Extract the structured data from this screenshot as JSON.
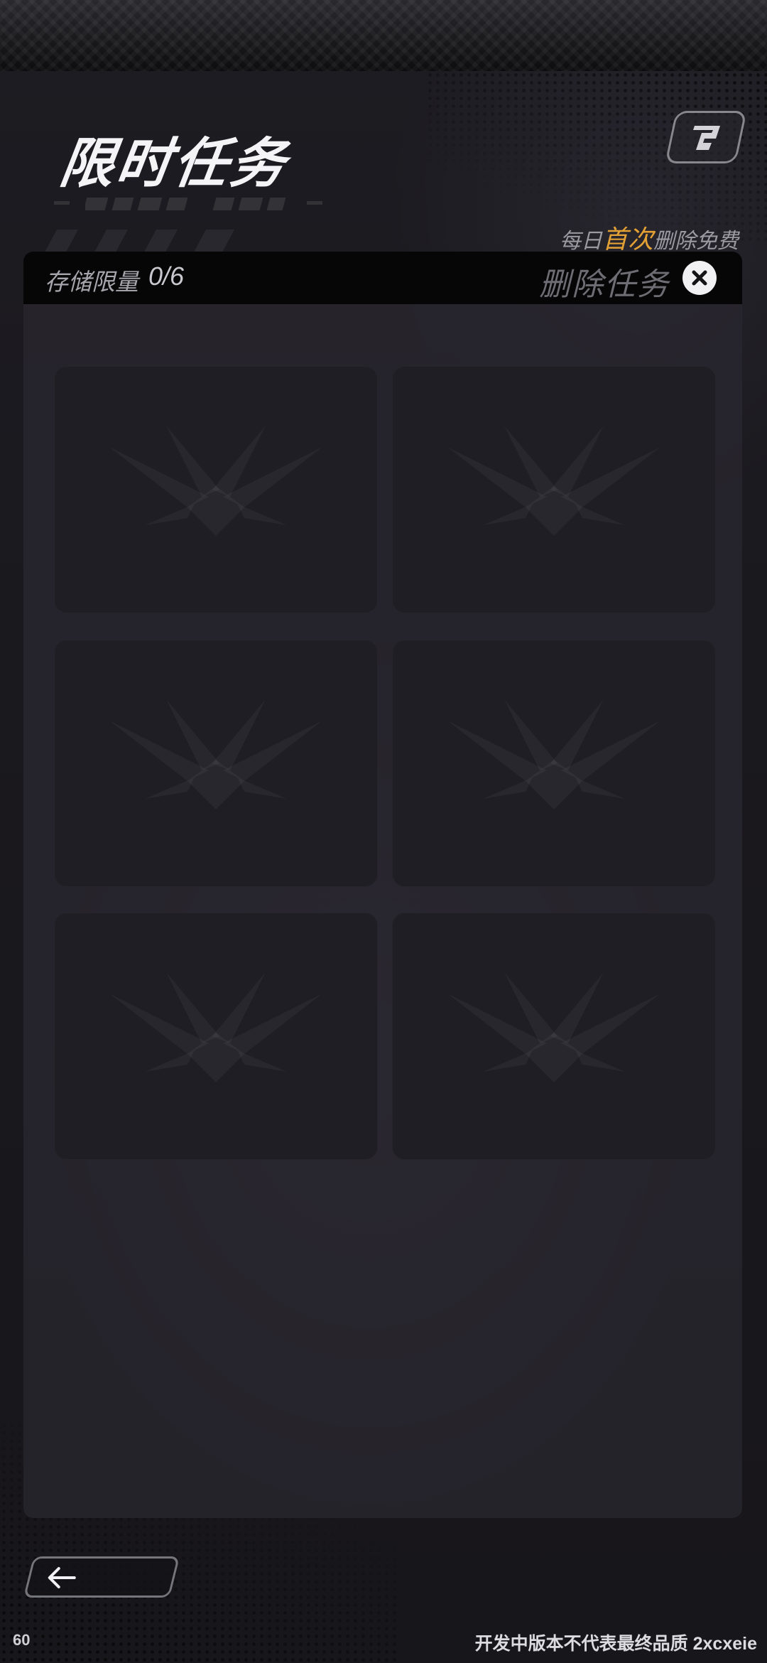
{
  "header": {
    "title": "限时任务",
    "help_icon": "help-logo-icon"
  },
  "notice": {
    "prefix": "每日",
    "highlight": "首次",
    "suffix": "删除免费",
    "highlight_color": "#e3a035"
  },
  "panel": {
    "storage_label": "存储限量",
    "storage_value": "0/6",
    "delete_label": "删除任务",
    "close_icon": "close-icon",
    "slots": [
      {
        "state": "empty",
        "icon": "faction-emblem-icon"
      },
      {
        "state": "empty",
        "icon": "faction-emblem-icon"
      },
      {
        "state": "empty",
        "icon": "faction-emblem-icon"
      },
      {
        "state": "empty",
        "icon": "faction-emblem-icon"
      },
      {
        "state": "empty",
        "icon": "faction-emblem-icon"
      },
      {
        "state": "empty",
        "icon": "faction-emblem-icon"
      }
    ]
  },
  "footer": {
    "back_icon": "arrow-left-icon",
    "fps": "60",
    "build_notice": "开发中版本不代表最终品质 2xcxeie"
  }
}
